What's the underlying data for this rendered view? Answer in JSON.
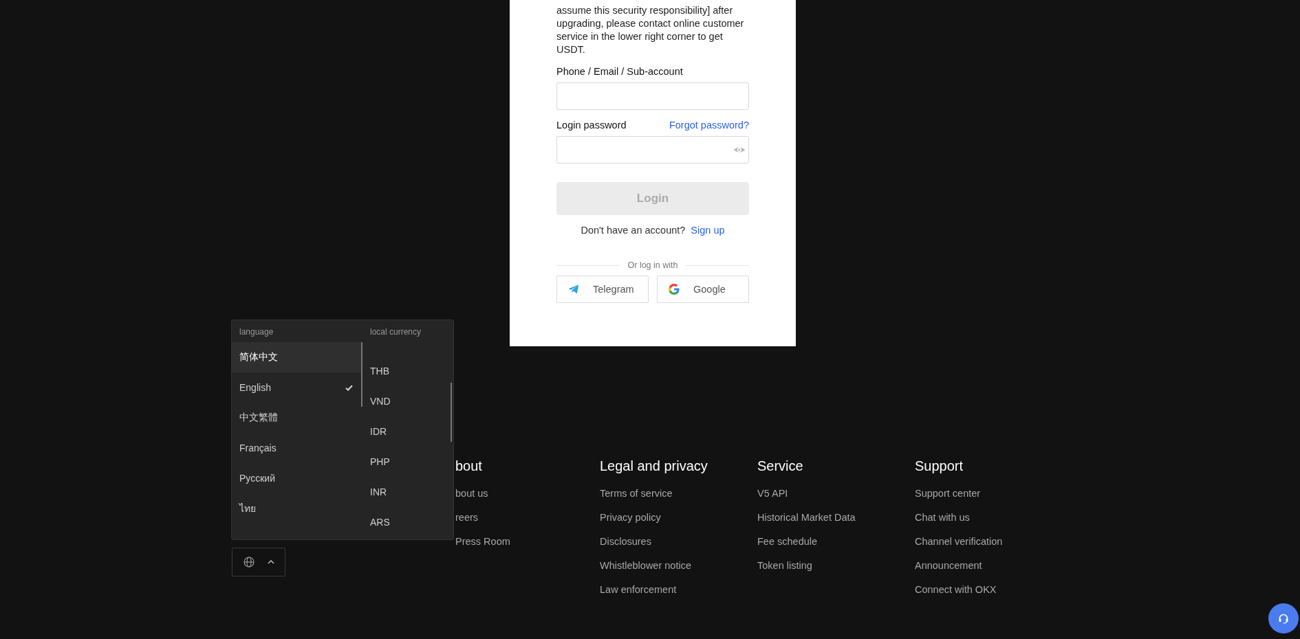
{
  "login_card": {
    "notice": "assume this security responsibility] after upgrading, please contact online customer service in the lower right corner to get USDT.",
    "fields": [
      {
        "label": "Phone / Email / Sub-account",
        "kind": "text"
      },
      {
        "label": "Login password",
        "link": "Forgot password?",
        "kind": "password"
      }
    ],
    "login_button": {
      "label": "Login",
      "disabled": true
    },
    "signup_prompt": "Don't have an account?",
    "signup_link": "Sign up",
    "divider_text": "Or log in with",
    "social_buttons": [
      {
        "label": "Telegram",
        "kind": "telegram"
      },
      {
        "label": "Google",
        "kind": "google"
      }
    ]
  },
  "language_menu": {
    "language_header": "language",
    "currency_header": "local currency",
    "languages": [
      {
        "label": "简体中文",
        "selected": false,
        "highlighted": true
      },
      {
        "label": "English",
        "selected": true,
        "highlighted": false
      },
      {
        "label": "中文繁體",
        "selected": false,
        "highlighted": false
      },
      {
        "label": "Français",
        "selected": false,
        "highlighted": false
      },
      {
        "label": "Русский",
        "selected": false,
        "highlighted": false
      },
      {
        "label": "ไทย",
        "selected": false,
        "highlighted": false
      }
    ],
    "currencies": [
      "THB",
      "VND",
      "IDR",
      "PHP",
      "INR",
      "ARS"
    ]
  },
  "footer": {
    "columns": [
      {
        "heading": "bout",
        "links": [
          "bout us",
          "reers",
          "Press Room"
        ]
      },
      {
        "heading": "Legal and privacy",
        "links": [
          "Terms of service",
          "Privacy policy",
          "Disclosures",
          "Whistleblower notice",
          "Law enforcement"
        ]
      },
      {
        "heading": "Service",
        "links": [
          "V5 API",
          "Historical Market Data",
          "Fee schedule",
          "Token listing"
        ]
      },
      {
        "heading": "Support",
        "links": [
          "Support center",
          "Chat with us",
          "Channel verification",
          "Announcement",
          "Connect with OKX"
        ]
      }
    ]
  }
}
